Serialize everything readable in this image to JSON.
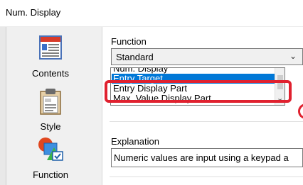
{
  "window": {
    "title": "Num. Display"
  },
  "sidebar": {
    "items": [
      {
        "label": "Contents",
        "icon": "contents-icon"
      },
      {
        "label": "Style",
        "icon": "style-icon"
      },
      {
        "label": "Function",
        "icon": "function-icon",
        "selected": true
      }
    ]
  },
  "function_section": {
    "label": "Function",
    "selected_value": "Standard",
    "options": [
      "Num. Display",
      "Entry Target",
      "Entry Display Part",
      "Max. Value Display Part"
    ],
    "highlighted_option": "Entry Target"
  },
  "explanation": {
    "label": "Explanation",
    "text": "Numeric values are input using a keypad a"
  },
  "colors": {
    "selection": "#0078d7",
    "callout": "#e0212f"
  }
}
